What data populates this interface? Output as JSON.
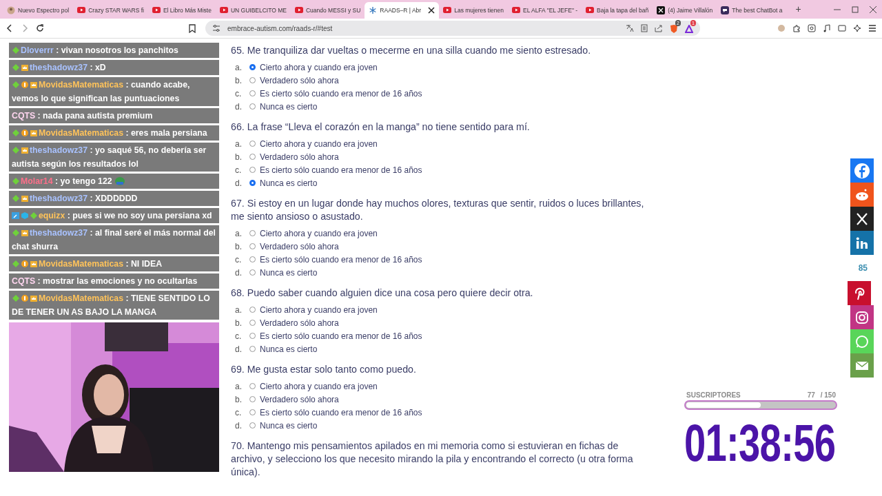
{
  "browser": {
    "tabs": [
      {
        "title": "Nuevo Espectro pol",
        "kind": "person",
        "selected": false
      },
      {
        "title": "Crazy STAR WARS fi",
        "kind": "youtube",
        "selected": false
      },
      {
        "title": "El Libro Más Miste",
        "kind": "youtube",
        "selected": false
      },
      {
        "title": "UN GUIBELCITO ME",
        "kind": "youtube",
        "selected": false
      },
      {
        "title": "Cuando MESSI y SU",
        "kind": "youtube",
        "selected": false
      },
      {
        "title": "RAADS–R | Abr",
        "kind": "raads",
        "selected": true
      },
      {
        "title": "Las mujeres tienen",
        "kind": "youtube",
        "selected": false
      },
      {
        "title": "EL ALFA \"EL JEFE\" -",
        "kind": "youtube",
        "selected": false
      },
      {
        "title": "Baja la tapa del bañ",
        "kind": "youtube",
        "selected": false
      },
      {
        "title": "(4) Jaime Villalón",
        "kind": "x",
        "selected": false
      },
      {
        "title": "The best ChatBot a",
        "kind": "chatbot",
        "selected": false
      }
    ],
    "new_tab": "+",
    "url": "embrace-autism.com/raads-r/#test",
    "brave_badge": "2",
    "alert_badge": "1"
  },
  "chat": [
    {
      "user": "Dloverrr",
      "color": "#a9c2ff",
      "badges": [
        {
          "kind": "gem"
        }
      ],
      "text": ": vivan nosotros los panchitos"
    },
    {
      "user": "theshadowz37",
      "color": "#a9c2ff",
      "badges": [
        {
          "kind": "gem"
        },
        {
          "kind": "crown"
        }
      ],
      "text": ": xD"
    },
    {
      "user": "MovidasMatematicas",
      "color": "#ffc35a",
      "badges": [
        {
          "kind": "gem"
        },
        {
          "kind": "sub"
        },
        {
          "kind": "crown"
        }
      ],
      "text": ": cuando acabe, vemos lo que significan las puntuaciones"
    },
    {
      "user": "CQTS",
      "color": "#ffd6f0",
      "text": ": nada pana autista premium"
    },
    {
      "user": "MovidasMatematicas",
      "color": "#ffc35a",
      "badges": [
        {
          "kind": "gem"
        },
        {
          "kind": "sub"
        },
        {
          "kind": "crown"
        }
      ],
      "text": ": eres mala persiana"
    },
    {
      "user": "theshadowz37",
      "color": "#a9c2ff",
      "badges": [
        {
          "kind": "gem"
        },
        {
          "kind": "crown"
        }
      ],
      "text": ": yo saqué 56, no debería ser autista según los resultados lol"
    },
    {
      "user": "Molar14",
      "color": "#ff6f8a",
      "badges": [
        {
          "kind": "gem"
        }
      ],
      "text": ": yo tengo 122",
      "emote": true
    },
    {
      "user": "theshadowz37",
      "color": "#a9c2ff",
      "badges": [
        {
          "kind": "gem"
        },
        {
          "kind": "crown"
        }
      ],
      "text": ": XDDDDDD"
    },
    {
      "user": "equizx",
      "color": "#ffc35a",
      "badges": [
        {
          "kind": "wrench"
        },
        {
          "kind": "cube"
        },
        {
          "kind": "gem"
        }
      ],
      "text": ": pues si we no soy una persiana xd"
    },
    {
      "user": "theshadowz37",
      "color": "#a9c2ff",
      "badges": [
        {
          "kind": "gem"
        },
        {
          "kind": "crown"
        }
      ],
      "text": ": al final seré el más normal del chat shurra"
    },
    {
      "user": "MovidasMatematicas",
      "color": "#ffc35a",
      "badges": [
        {
          "kind": "gem"
        },
        {
          "kind": "sub"
        },
        {
          "kind": "crown"
        }
      ],
      "text": ": NI IDEA"
    },
    {
      "user": "CQTS",
      "color": "#ffd6f0",
      "text": ": mostrar las emociones y no ocultarlas"
    },
    {
      "user": "MovidasMatematicas",
      "color": "#ffc35a",
      "badges": [
        {
          "kind": "gem"
        },
        {
          "kind": "sub"
        },
        {
          "kind": "crown"
        }
      ],
      "text": ": TIENE SENTIDO LO DE TENER UN AS BAJO LA MANGA"
    }
  ],
  "questions": [
    {
      "text": "65. Me tranquiliza dar vueltas o mecerme en una silla cuando me siento estresado.",
      "options": [
        {
          "letter": "a.",
          "label": "Cierto ahora y cuando era joven",
          "selected": true
        },
        {
          "letter": "b.",
          "label": "Verdadero sólo ahora",
          "selected": false
        },
        {
          "letter": "c.",
          "label": "Es cierto sólo cuando era menor de 16 años",
          "selected": false
        },
        {
          "letter": "d.",
          "label": "Nunca es cierto",
          "selected": false
        }
      ]
    },
    {
      "text": "66. La frase “Lleva el corazón en la manga” no tiene sentido para mí.",
      "options": [
        {
          "letter": "a.",
          "label": "Cierto ahora y cuando era joven",
          "selected": false
        },
        {
          "letter": "b.",
          "label": "Verdadero sólo ahora",
          "selected": false
        },
        {
          "letter": "c.",
          "label": "Es cierto sólo cuando era menor de 16 años",
          "selected": false
        },
        {
          "letter": "d.",
          "label": "Nunca es cierto",
          "selected": true
        }
      ]
    },
    {
      "text": "67. Si estoy en un lugar donde hay muchos olores, texturas que sentir, ruidos o luces brillantes, me siento ansioso o asustado.",
      "options": [
        {
          "letter": "a.",
          "label": "Cierto ahora y cuando era joven",
          "selected": false
        },
        {
          "letter": "b.",
          "label": "Verdadero sólo ahora",
          "selected": false
        },
        {
          "letter": "c.",
          "label": "Es cierto sólo cuando era menor de 16 años",
          "selected": false
        },
        {
          "letter": "d.",
          "label": "Nunca es cierto",
          "selected": false
        }
      ]
    },
    {
      "text": "68. Puedo saber cuando alguien dice una cosa pero quiere decir otra.",
      "options": [
        {
          "letter": "a.",
          "label": "Cierto ahora y cuando era joven",
          "selected": false
        },
        {
          "letter": "b.",
          "label": "Verdadero sólo ahora",
          "selected": false
        },
        {
          "letter": "c.",
          "label": "Es cierto sólo cuando era menor de 16 años",
          "selected": false
        },
        {
          "letter": "d.",
          "label": "Nunca es cierto",
          "selected": false
        }
      ]
    },
    {
      "text": "69. Me gusta estar solo tanto como puedo.",
      "options": [
        {
          "letter": "a.",
          "label": "Cierto ahora y cuando era joven",
          "selected": false
        },
        {
          "letter": "b.",
          "label": "Verdadero sólo ahora",
          "selected": false
        },
        {
          "letter": "c.",
          "label": "Es cierto sólo cuando era menor de 16 años",
          "selected": false
        },
        {
          "letter": "d.",
          "label": "Nunca es cierto",
          "selected": false
        }
      ]
    },
    {
      "text": "70. Mantengo mis pensamientos apilados en mi memoria como si estuvieran en fichas de archivo, y selecciono los que necesito mirando la pila y encontrando el correcto (u otra forma única)."
    }
  ],
  "share": {
    "buttons": [
      {
        "kind": "facebook"
      },
      {
        "kind": "reddit"
      },
      {
        "kind": "x"
      },
      {
        "kind": "linkedin"
      },
      {
        "kind": "pinterest"
      },
      {
        "kind": "instagram"
      },
      {
        "kind": "whatsapp"
      },
      {
        "kind": "email"
      }
    ],
    "count": "85"
  },
  "subs_goal": {
    "label": "SUSCRIPTORES",
    "count": "77",
    "goal": "/ 150",
    "level": 0.5
  },
  "timer": "01:38:56"
}
